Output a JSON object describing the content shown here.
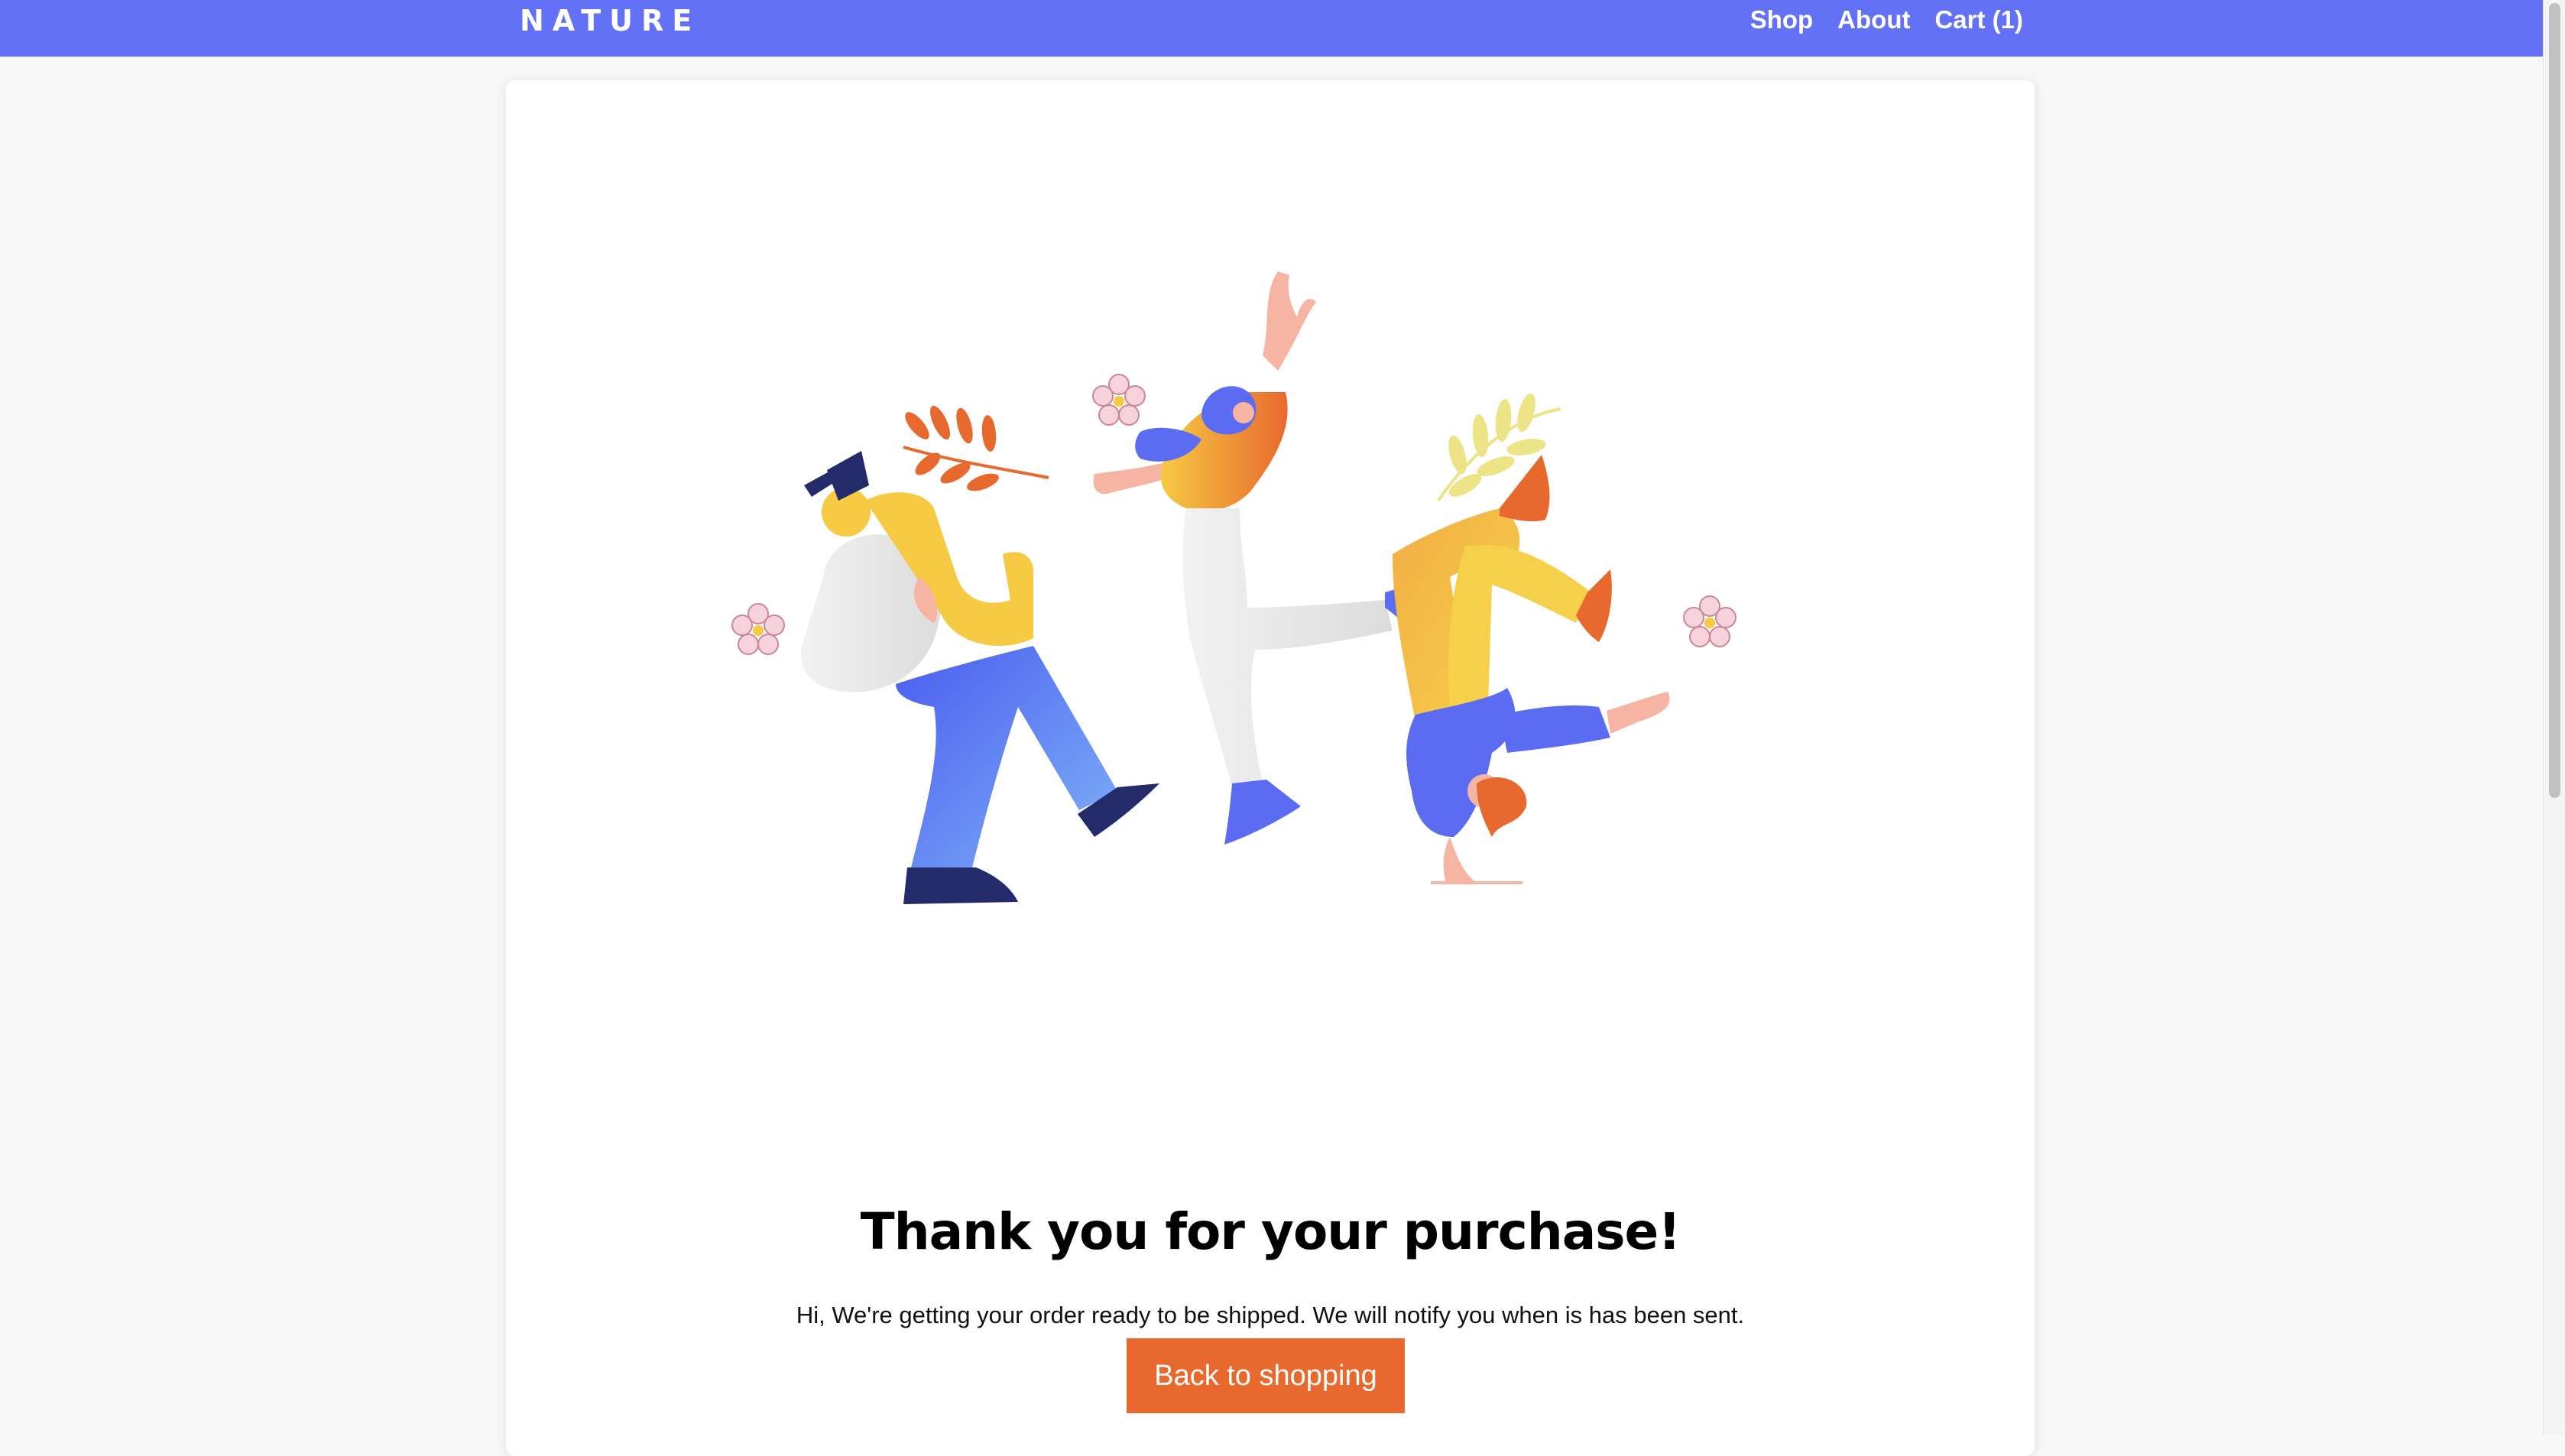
{
  "nav": {
    "brand": "NATURE",
    "links": [
      {
        "label": "Shop"
      },
      {
        "label": "About"
      },
      {
        "label": "Cart (1)"
      }
    ]
  },
  "main": {
    "title": "Thank you for your purchase!",
    "message": "Hi, We're getting your order ready to be shipped. We will notify you when is has been sent.",
    "button_label": "Back to shopping"
  },
  "colors": {
    "nav_bg": "#6271f6",
    "accent": "#e8692e",
    "yellow": "#f6ca43",
    "blue": "#5b6cf3",
    "navy": "#232b6b"
  }
}
